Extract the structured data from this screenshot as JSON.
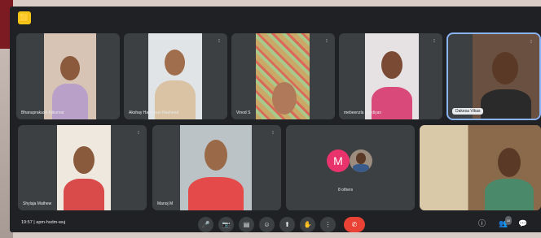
{
  "app": {
    "logo_glyph": "🟨"
  },
  "participants_row1": [
    {
      "name": "Bhanuprakash Ajikumar",
      "label_boxed": false
    },
    {
      "name": "Akshay Hariharan Rasheed",
      "label_boxed": false
    },
    {
      "name": "Vinod S",
      "label_boxed": false
    },
    {
      "name": "mebeenzla pandiyan",
      "label_boxed": false
    },
    {
      "name": "Dakesa Vikas",
      "label_boxed": true
    }
  ],
  "participants_row2": [
    {
      "name": "Shylaja Mathew"
    },
    {
      "name": "Manoj M"
    },
    {
      "name": "8 others",
      "avatar_letter": "M"
    },
    {
      "name": ""
    }
  ],
  "more_glyph": "⁝",
  "toolbar": {
    "time": "19:57",
    "separator": "|",
    "meeting_code": "apm-hsdm-wuj",
    "buttons": [
      "🎤",
      "📷",
      "▤",
      "☺",
      "⬆",
      "✋",
      "⋮",
      "✆"
    ],
    "right_icons": [
      "ⓘ",
      "👥",
      "💬"
    ],
    "people_count": "18"
  },
  "colors": {
    "accent": "#8ab4f8",
    "end_call": "#ea4335",
    "avatar": "#e8336c"
  }
}
